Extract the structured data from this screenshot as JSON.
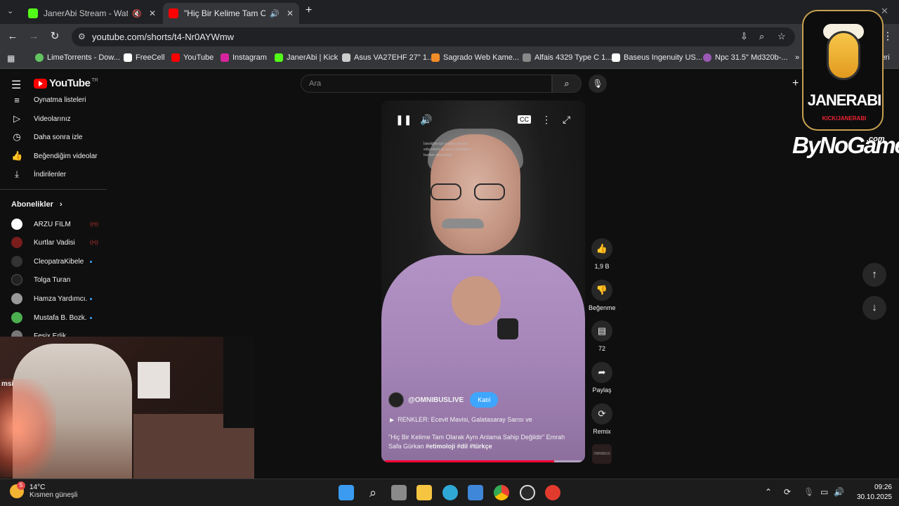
{
  "browser": {
    "tabs": [
      {
        "title": "JanerAbi Stream - Watch Live",
        "muted": true,
        "active": false,
        "color": "#53fc18"
      },
      {
        "title": "\"Hiç Bir Kelime Tam Olarak Aynı",
        "muted": false,
        "active": true,
        "color": "#ff0000"
      }
    ],
    "new_tab": "+",
    "url": "youtube.com/shorts/t4-Nr0AYWmw",
    "bookmarks": [
      {
        "label": "LimeTorrents - Dow...",
        "color": "#62c462"
      },
      {
        "label": "FreeCell",
        "color": "#ffffff"
      },
      {
        "label": "YouTube",
        "color": "#ff0000"
      },
      {
        "label": "Instagram",
        "color": "#d6249f"
      },
      {
        "label": "JanerAbi | Kick",
        "color": "#53fc18"
      },
      {
        "label": "Asus VA27EHF 27\" 1...",
        "color": "#cccccc"
      },
      {
        "label": "Sagrado Web Kame...",
        "color": "#f28c28"
      },
      {
        "label": "Alfais 4329 Type C 1...",
        "color": "#888888"
      },
      {
        "label": "Baseus Ingenuity US...",
        "color": "#ffffff"
      },
      {
        "label": "Npc 31.5\" Md320b-...",
        "color": "#9b59b6"
      }
    ],
    "bookmarks_more": "»",
    "bookmarks_cut": "leri"
  },
  "youtube": {
    "logo_word": "YouTube",
    "logo_tr": "TR",
    "search_placeholder": "Ara",
    "create": "+",
    "nav": [
      {
        "label": "Oynatma listeleri",
        "icon": "playlist-icon",
        "glyph": "≡"
      },
      {
        "label": "Videolarınız",
        "icon": "your-videos-icon",
        "glyph": "▷"
      },
      {
        "label": "Daha sonra izle",
        "icon": "clock-icon",
        "glyph": "◷"
      },
      {
        "label": "Beğendiğim videolar",
        "icon": "thumbs-up-icon",
        "glyph": "👍"
      },
      {
        "label": "İndirilenler",
        "icon": "download-icon",
        "glyph": "⤓"
      }
    ],
    "subscriptions_title": "Abonelikler",
    "subscriptions": [
      {
        "name": "ARZU FİLM",
        "status": "live",
        "color": "#ffffff"
      },
      {
        "name": "Kurtlar Vadisi",
        "status": "live",
        "color": "#7a1d1d"
      },
      {
        "name": "CleopatraKibele",
        "status": "dot",
        "color": "#333333"
      },
      {
        "name": "Tolga Turan",
        "status": "none",
        "color": "#222222"
      },
      {
        "name": "Hamza Yardımcı...",
        "status": "dot",
        "color": "#999999"
      },
      {
        "name": "Mustafa B. Bozk...",
        "status": "dot",
        "color": "#4caf50"
      },
      {
        "name": "Fesix Erlik",
        "status": "none",
        "color": "#777777"
      }
    ],
    "live_glyph": "((•))",
    "short": {
      "overlay_text": "İstediğim için burdan devam ediyordum şu sesi o kelimeleri burdan okuyorduk",
      "channel": "@OMNIBUSLIVE",
      "join": "Katıl",
      "music": "RENKLER: Ecevit Mavisi, Galatasaray Sarısı ve",
      "description": "\"Hiç Bir Kelime Tam Olarak Aynı Anlama Sahip Değildir\" Emrah Safa Gürkan",
      "hashtags": "#etimoloji #dil #türkçe",
      "progress": 0.86,
      "channel_thumb": "OMNIBUS"
    },
    "actions": {
      "likes": "1,9 B",
      "dislike": "Beğenme",
      "comments": "72",
      "share": "Paylaş",
      "remix": "Remix"
    }
  },
  "overlay": {
    "logo_word": "JANERABI",
    "logo_sub": "KICK/JANERABI",
    "sponsor": "ByNoGame",
    "sponsor_suffix": ".com",
    "webcam_brand": "msi"
  },
  "taskbar": {
    "badge": "5",
    "temperature": "14°C",
    "weather": "Kısmen güneşli",
    "time": "09:26",
    "date": "30.10.2025"
  }
}
